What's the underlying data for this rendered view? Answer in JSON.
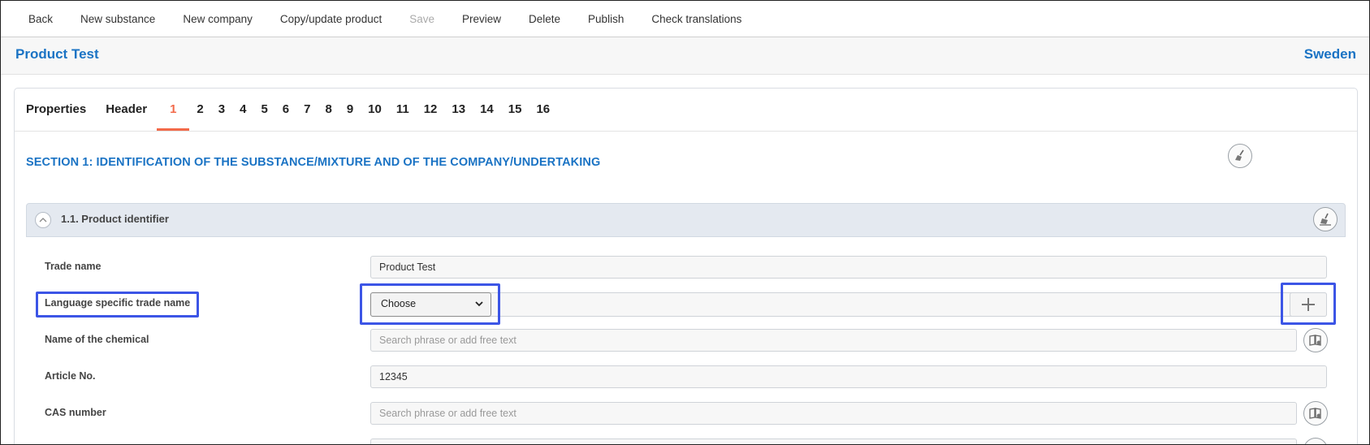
{
  "toolbar": {
    "items": [
      "Back",
      "New substance",
      "New company",
      "Copy/update product",
      "Save",
      "Preview",
      "Delete",
      "Publish",
      "Check translations"
    ]
  },
  "header": {
    "title": "Product Test",
    "country": "Sweden"
  },
  "tabs": [
    "Properties",
    "Header",
    "1",
    "2",
    "3",
    "4",
    "5",
    "6",
    "7",
    "8",
    "9",
    "10",
    "11",
    "12",
    "13",
    "14",
    "15",
    "16"
  ],
  "active_tab": "1",
  "section": {
    "title": "SECTION 1: IDENTIFICATION OF THE SUBSTANCE/MIXTURE AND OF THE COMPANY/UNDERTAKING"
  },
  "subsection": {
    "label": "1.1. Product identifier"
  },
  "fields": {
    "trade_name": {
      "label": "Trade name",
      "value": "Product Test"
    },
    "language_trade_name": {
      "label": "Language specific trade name",
      "select_value": "Choose"
    },
    "chemical_name": {
      "label": "Name of the chemical",
      "placeholder": "Search phrase or add free text"
    },
    "article_no": {
      "label": "Article No.",
      "value": "12345"
    },
    "cas_number": {
      "label": "CAS number",
      "placeholder": "Search phrase or add free text"
    }
  },
  "colors": {
    "accent": "#1a73c4",
    "active_tab": "#f26a4a",
    "highlight": "#3c55e6"
  },
  "icons": [
    "broom-icon",
    "broom-icon",
    "chevron-up-icon",
    "chevron-down-icon",
    "plus-icon",
    "phrase-book-icon"
  ]
}
